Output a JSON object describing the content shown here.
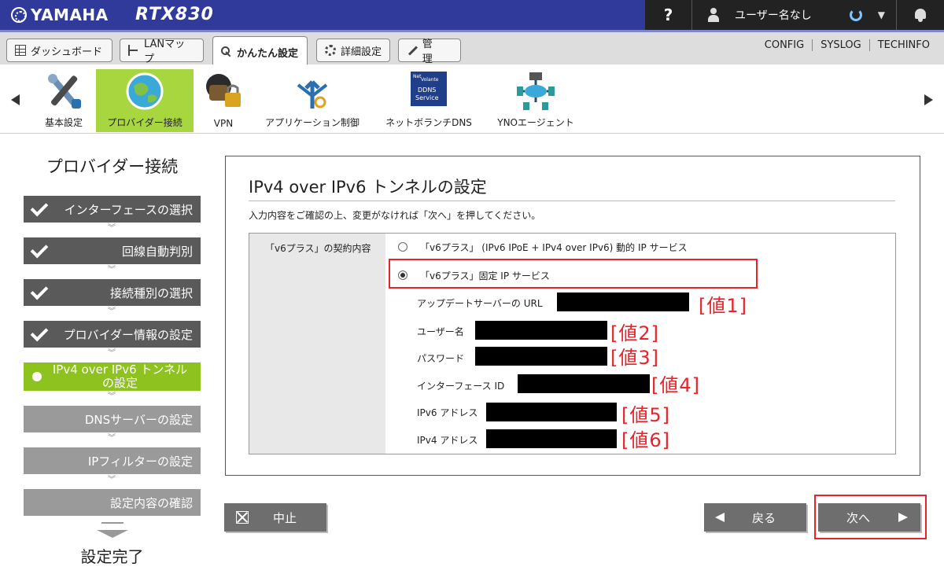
{
  "topbar": {
    "brand": "YAMAHA",
    "model": "RTX830",
    "help": "?",
    "user": "ユーザー名なし"
  },
  "nav": {
    "tabs": [
      {
        "label": "ダッシュボード",
        "icon": "dashboard-grid-icon"
      },
      {
        "label": "LANマップ",
        "icon": "lan-map-icon"
      },
      {
        "label": "かんたん設定",
        "icon": "key-icon"
      },
      {
        "label": "詳細設定",
        "icon": "gear-icon"
      },
      {
        "label": "管　理",
        "icon": "wrench-icon"
      }
    ],
    "links": [
      "CONFIG",
      "SYSLOG",
      "TECHINFO"
    ]
  },
  "features": [
    {
      "label": "基本設定",
      "icon": "tools-icon"
    },
    {
      "label": "プロバイダー接続",
      "icon": "globe-icon"
    },
    {
      "label": "VPN",
      "icon": "vpn-icon"
    },
    {
      "label": "アプリケーション制御",
      "icon": "app-control-icon"
    },
    {
      "label": "ネットボランチDNS",
      "icon": "ddns-icon",
      "icon_text": [
        "Net",
        "Volante",
        "DDNS",
        "Service"
      ]
    },
    {
      "label": "YNOエージェント",
      "icon": "yno-icon"
    }
  ],
  "sidebar": {
    "title": "プロバイダー接続",
    "steps": [
      {
        "label": "インターフェースの選択",
        "state": "done"
      },
      {
        "label": "回線自動判別",
        "state": "done"
      },
      {
        "label": "接続種別の選択",
        "state": "done"
      },
      {
        "label": "プロバイダー情報の設定",
        "state": "done"
      },
      {
        "label": "IPv4 over IPv6 トンネルの設定",
        "state": "current"
      },
      {
        "label": "DNSサーバーの設定",
        "state": "todo"
      },
      {
        "label": "IPフィルターの設定",
        "state": "todo"
      },
      {
        "label": "設定内容の確認",
        "state": "todo"
      }
    ],
    "finish": "設定完了"
  },
  "main": {
    "title": "IPv4 over IPv6 トンネルの設定",
    "description": "入力内容をご確認の上、変更がなければ「次へ」を押してください。",
    "contract_label": "「v6プラス」の契約内容",
    "options": [
      {
        "label": "「v6プラス」 (IPv6 IPoE + IPv4 over IPv6) 動的 IP サービス",
        "selected": false
      },
      {
        "label": "「v6プラス」固定 IP サービス",
        "selected": true
      }
    ],
    "fields": [
      {
        "label": "アップデートサーバーの URL",
        "value_tag": "[値1]"
      },
      {
        "label": "ユーザー名",
        "value_tag": "[値2]"
      },
      {
        "label": "パスワード",
        "value_tag": "[値3]"
      },
      {
        "label": "インターフェース ID",
        "value_tag": "[値4]"
      },
      {
        "label": "IPv6 アドレス",
        "value_tag": "[値5]"
      },
      {
        "label": "IPv4 アドレス",
        "value_tag": "[値6]"
      }
    ]
  },
  "buttons": {
    "cancel": "中止",
    "back": "戻る",
    "next": "次へ"
  },
  "colors": {
    "header_blue": "#2f3a9b",
    "accent_green": "#8ec31f",
    "highlight_red": "#e8232a"
  }
}
